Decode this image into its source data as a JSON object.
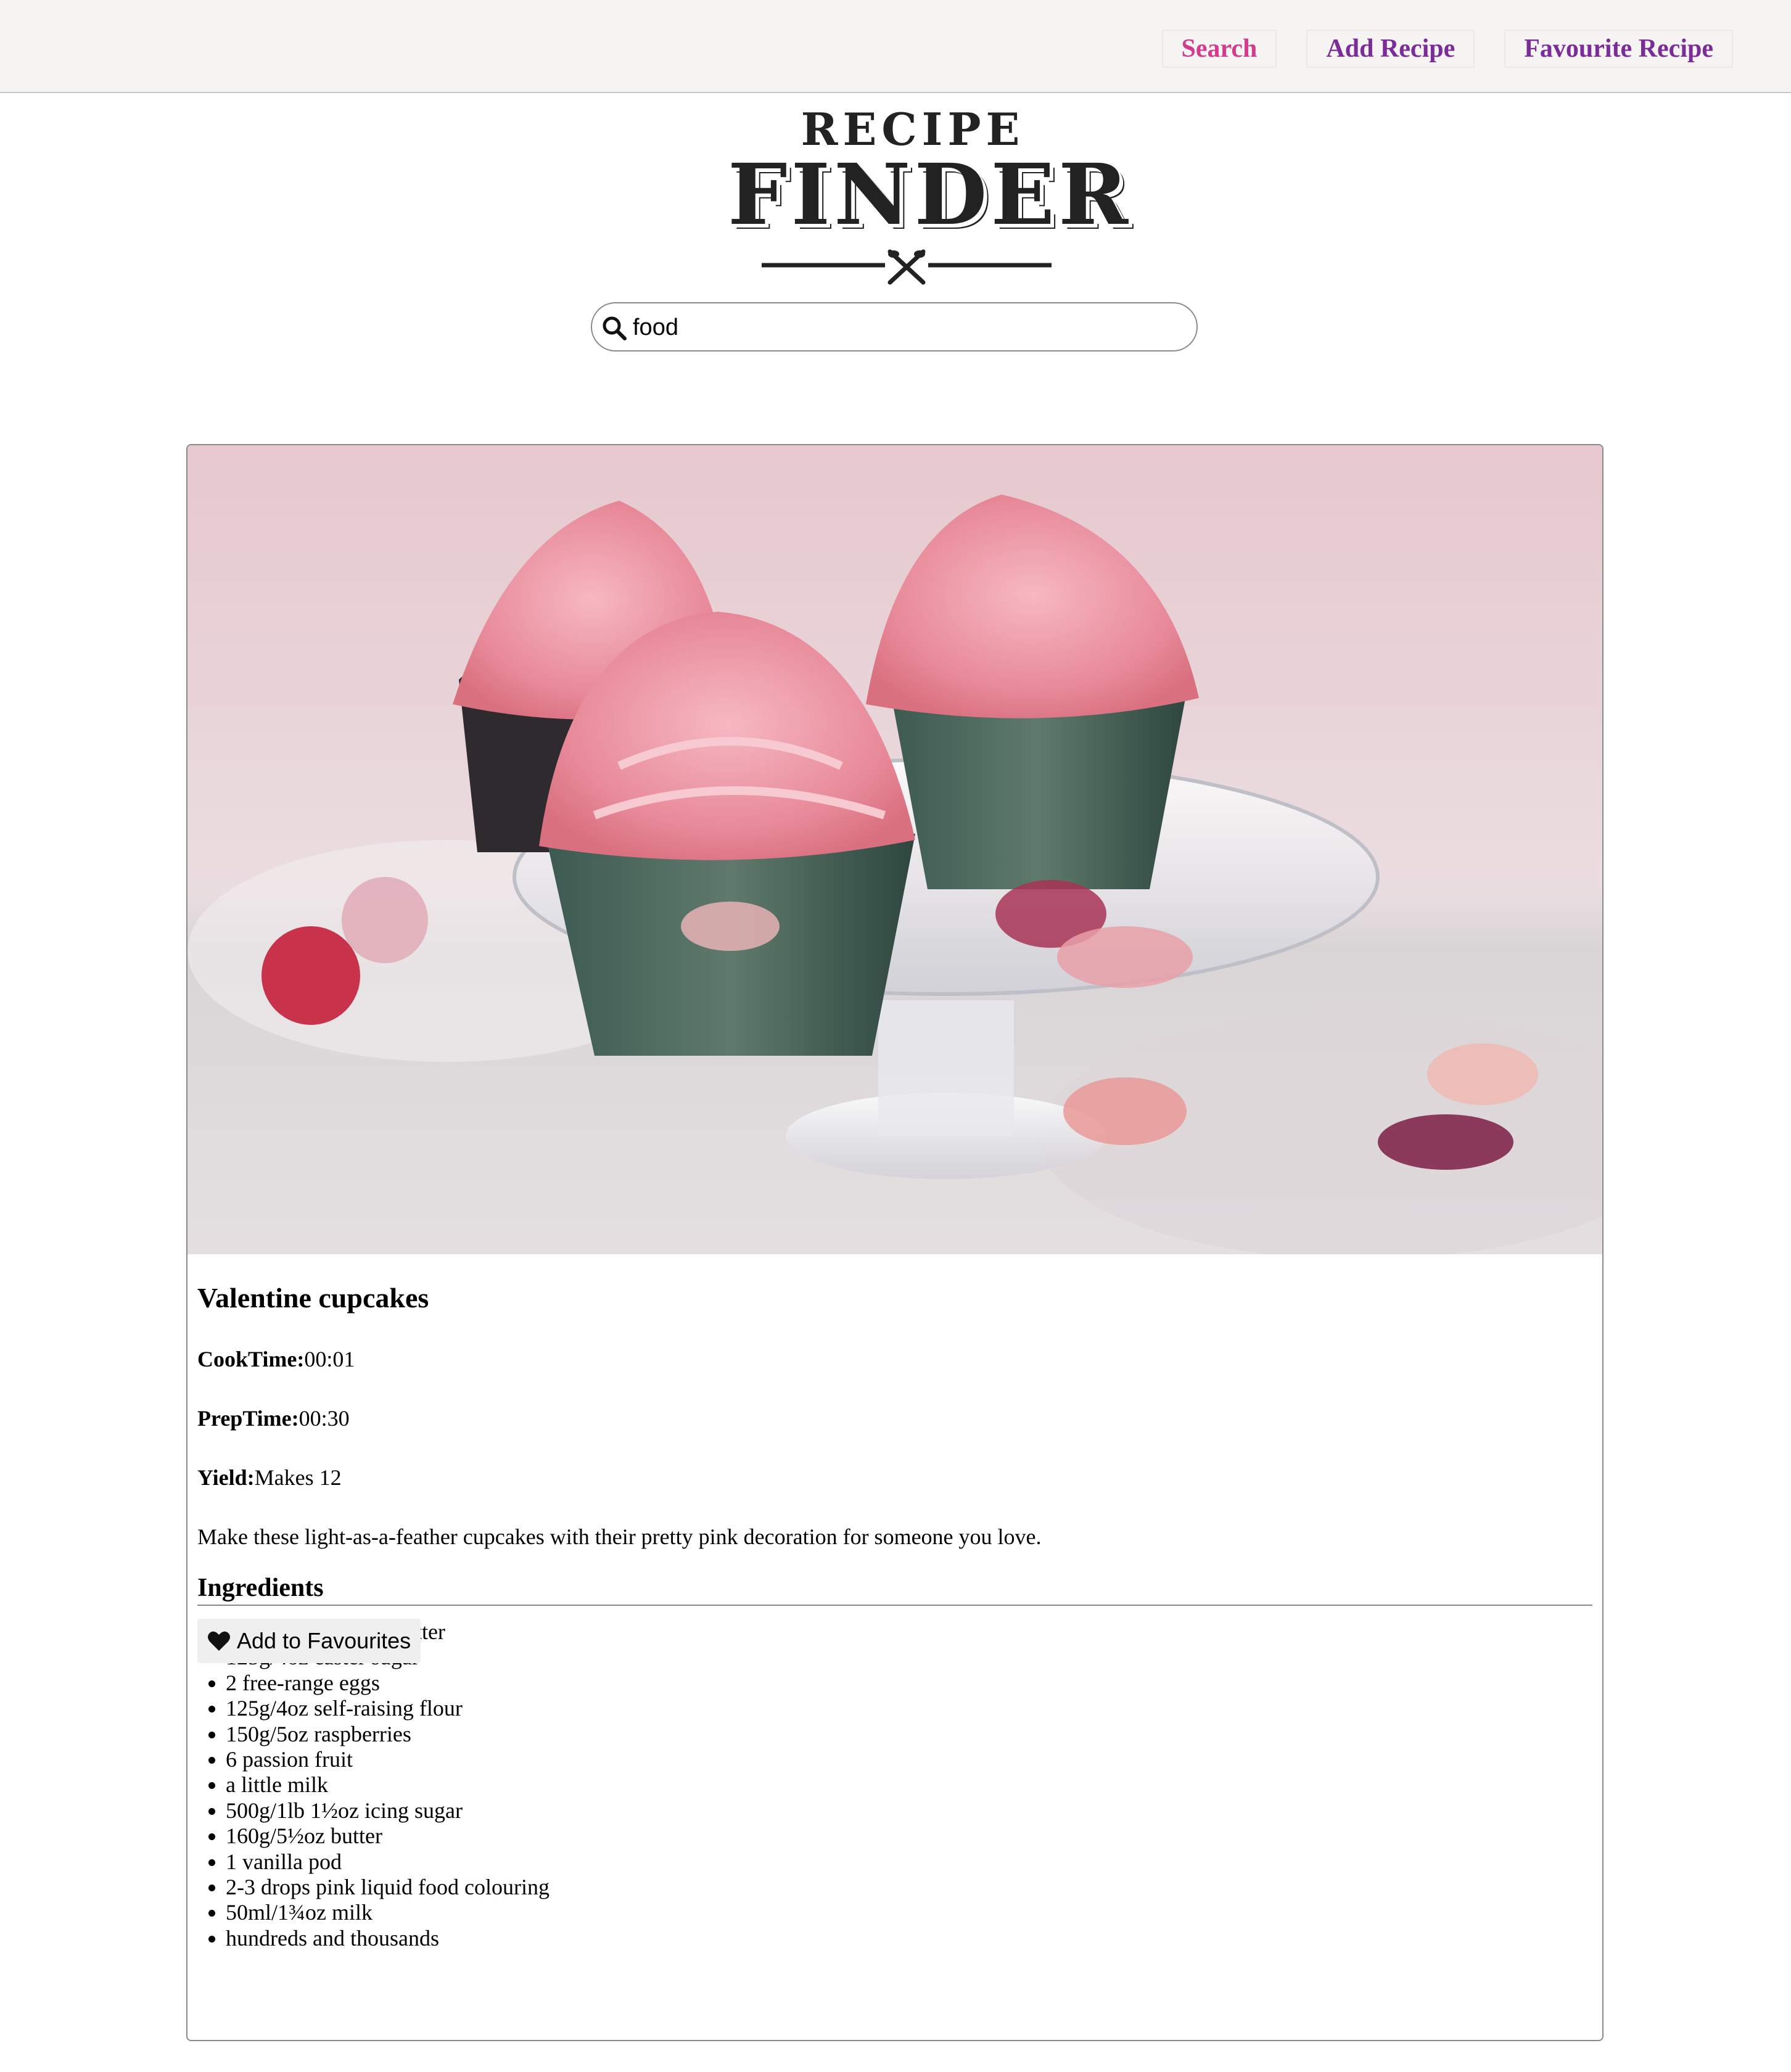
{
  "nav": {
    "items": [
      {
        "label": "Search",
        "active": true
      },
      {
        "label": "Add Recipe",
        "active": false
      },
      {
        "label": "Favourite Recipe",
        "active": false
      }
    ]
  },
  "logo": {
    "line1": "RECIPE",
    "line2": "FINDER"
  },
  "search": {
    "value": "food"
  },
  "recipe": {
    "title": "Valentine cupcakes",
    "cook_time_label": "CookTime:",
    "cook_time": "00:01",
    "prep_time_label": "PrepTime:",
    "prep_time": "00:30",
    "yield_label": "Yield:",
    "yield": "Makes 12",
    "description": "Make these light-as-a-feather cupcakes with their pretty pink decoration for someone you love.",
    "ingredients_heading": "Ingredients",
    "ingredients": [
      "125g/4oz unsalted butter",
      "125g/4oz caster sugar",
      "2 free-range eggs",
      "125g/4oz self-raising flour",
      "150g/5oz raspberries",
      "6 passion fruit",
      "a little milk",
      "500g/1lb 1½oz icing sugar",
      "160g/5½oz butter",
      "1 vanilla pod",
      "2-3 drops pink liquid food colouring",
      "50ml/1¾oz milk",
      "hundreds and thousands"
    ],
    "favourite_button": "Add to Favourites"
  },
  "colors": {
    "nav_active": "#d23c8c",
    "nav_normal": "#7a2c98",
    "topbar_bg": "#f6f3f3"
  }
}
